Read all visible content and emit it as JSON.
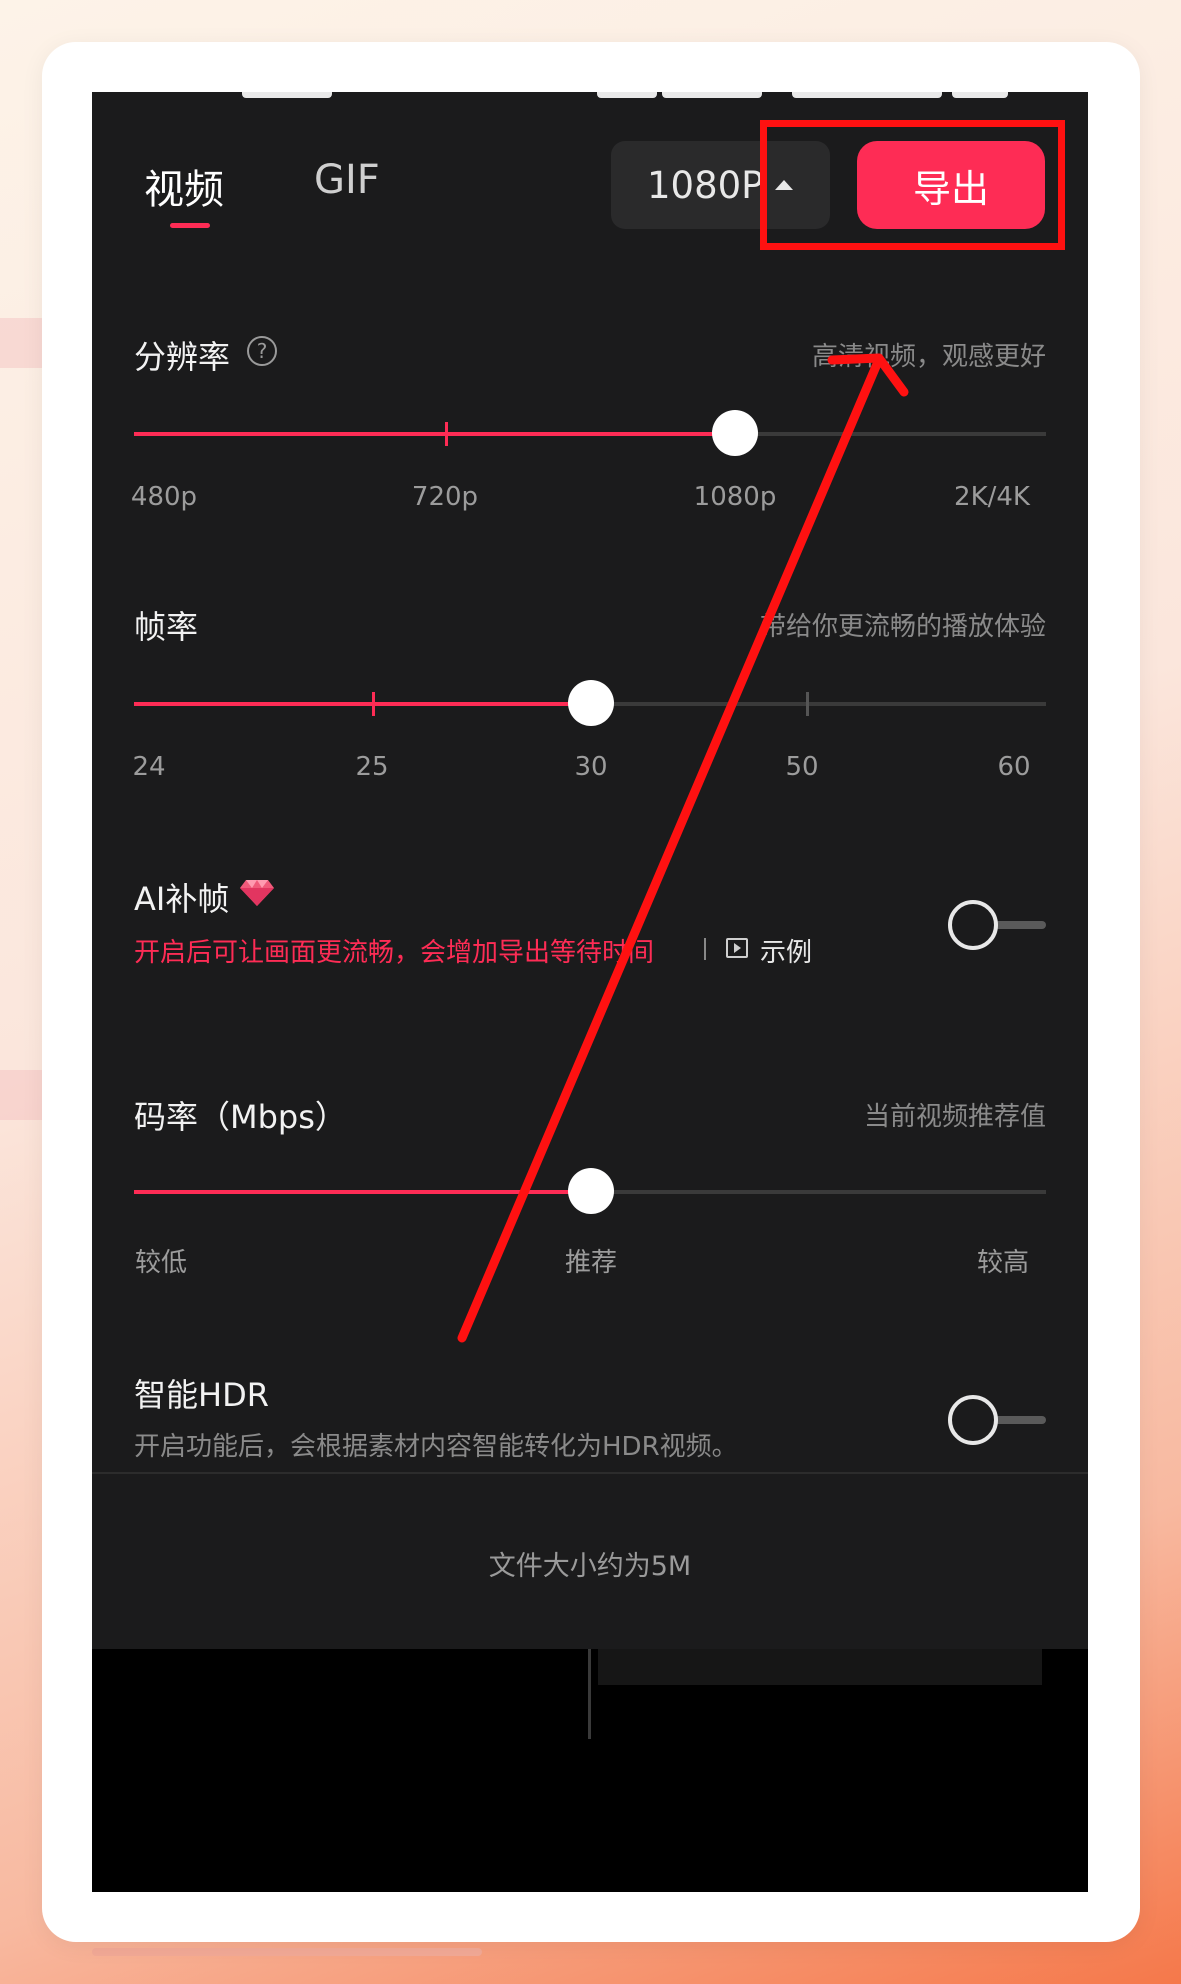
{
  "tabs": [
    {
      "label": "视频",
      "active": true
    },
    {
      "label": "GIF",
      "active": false
    }
  ],
  "resolution_select": {
    "value": "1080P"
  },
  "export_button": {
    "label": "导出"
  },
  "resolution": {
    "label": "分辨率",
    "hint": "高清视频，观感更好",
    "options": [
      "480p",
      "720p",
      "1080p",
      "2K/4K"
    ],
    "selected": "1080p"
  },
  "frame_rate": {
    "label": "帧率",
    "hint": "带给你更流畅的播放体验",
    "options": [
      "24",
      "25",
      "30",
      "50",
      "60"
    ],
    "selected": "30"
  },
  "ai_frame": {
    "label": "AI补帧",
    "description": "开启后可让画面更流畅，会增加导出等待时间",
    "example_label": "示例",
    "enabled": false
  },
  "bitrate": {
    "label": "码率（Mbps）",
    "hint": "当前视频推荐值",
    "options": [
      "较低",
      "推荐",
      "较高"
    ],
    "selected": "推荐"
  },
  "smart_hdr": {
    "label": "智能HDR",
    "description": "开启功能后，会根据素材内容智能转化为HDR视频。",
    "enabled": false
  },
  "file_size": "文件大小约为5M",
  "colors": {
    "accent": "#fe2c55",
    "background": "#1b1b1c",
    "annotation": "#ff1111"
  }
}
